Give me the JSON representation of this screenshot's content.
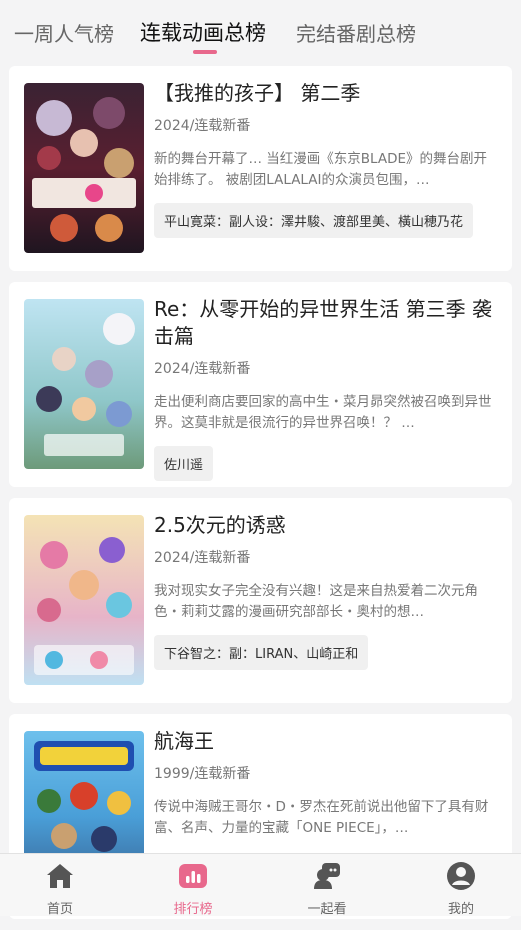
{
  "tabs": [
    {
      "label": "一周人气榜"
    },
    {
      "label": "连载动画总榜"
    },
    {
      "label": "完结番剧总榜"
    }
  ],
  "cards": [
    {
      "title": "【我推的孩子】 第二季",
      "meta": "2024/连载新番",
      "desc": "新的舞台开幕了… 当红漫画《东京BLADE》的舞台剧开始排练了。 被剧团LALALAI的众演员包围，…",
      "staff": "平山寛菜：副人设：澤井駿、渡部里美、橫山穂乃花"
    },
    {
      "title": "Re：从零开始的异世界生活 第三季 袭击篇",
      "meta": "2024/连载新番",
      "desc": "走出便利商店要回家的高中生・菜月昴突然被召唤到异世界。这莫非就是很流行的异世界召唤！？ …",
      "staff": "佐川遥"
    },
    {
      "title": "2.5次元的诱惑",
      "meta": "2024/连载新番",
      "desc": "我对现实女子完全没有兴趣！这是来自热爱着二次元角色・莉莉艾露的漫画研究部部长・奥村的想…",
      "staff": "下谷智之：副：LIRAN、山崎正和"
    },
    {
      "title": "航海王",
      "meta": "1999/连载新番",
      "desc": "传说中海贼王哥尔・D・罗杰在死前说出他留下了具有财富、名声、力量的宝藏「ONE PIECE」，…",
      "staff": ""
    }
  ],
  "nav": [
    {
      "label": "首页",
      "icon": "home-icon"
    },
    {
      "label": "排行榜",
      "icon": "ranking-icon"
    },
    {
      "label": "一起看",
      "icon": "watch-together-icon"
    },
    {
      "label": "我的",
      "icon": "profile-icon"
    }
  ],
  "colors": {
    "accent": "#e8688c",
    "background": "#f4f4f5"
  }
}
